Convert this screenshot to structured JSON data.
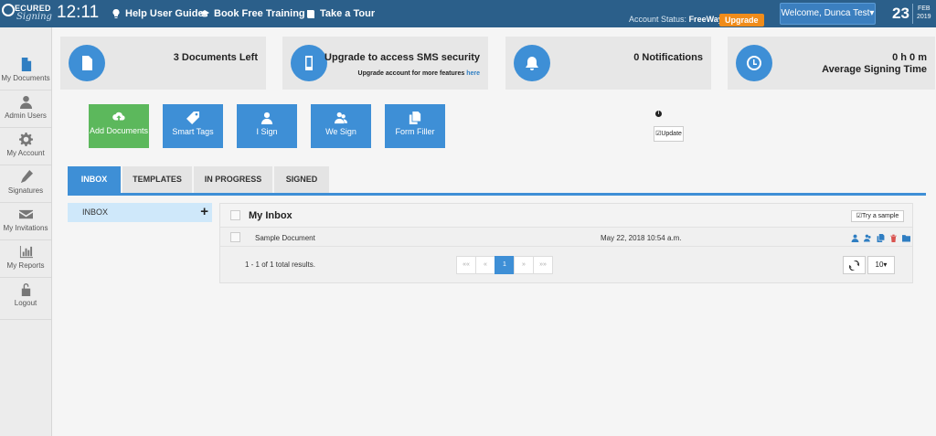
{
  "header": {
    "logo_top": "ECURED",
    "logo_script": "Signing",
    "time": "12:11",
    "nav": [
      "Help User Guide",
      "Book Free Training",
      "Take a Tour"
    ],
    "account_status_label": "Account Status:",
    "account_plan": "FreeWay",
    "upgrade_label": "Upgrade",
    "welcome": "Welcome, Dunca Test▾",
    "date_day": "23",
    "date_month": "FEB",
    "date_year": "2019"
  },
  "sidebar": {
    "items": [
      {
        "label": "My Documents",
        "icon": "document-icon"
      },
      {
        "label": "Admin Users",
        "icon": "user-icon"
      },
      {
        "label": "My Account",
        "icon": "gear-icon"
      },
      {
        "label": "Signatures",
        "icon": "pen-icon"
      },
      {
        "label": "My Invitations",
        "icon": "envelope-icon"
      },
      {
        "label": "My Reports",
        "icon": "bar-chart-icon"
      },
      {
        "label": "Logout",
        "icon": "lock-icon"
      }
    ]
  },
  "stats": {
    "documents_left": "3 Documents Left",
    "sms_title": "Upgrade to access SMS security",
    "sms_sub": "Upgrade account for more features",
    "sms_link": "here",
    "notifications": "0 Notifications",
    "signing_time_value": "0 h 0 m",
    "signing_time_label": "Average Signing Time"
  },
  "actions": {
    "add_documents": "Add Documents",
    "smart_tags": "Smart Tags",
    "i_sign": "I Sign",
    "we_sign": "We Sign",
    "form_filler": "Form Filler",
    "update": "Update"
  },
  "tabs": [
    "INBOX",
    "TEMPLATES",
    "IN PROGRESS",
    "SIGNED"
  ],
  "folders": {
    "inbox": "INBOX"
  },
  "inbox": {
    "title": "My Inbox",
    "try_sample": "Try a sample",
    "rows": [
      {
        "name": "Sample Document",
        "date": "May 22, 2018 10:54 a.m."
      }
    ],
    "results": "1 - 1 of 1 total results.",
    "pager": [
      "««",
      "«",
      "1",
      "»",
      "»»"
    ],
    "page_size": "10▾"
  },
  "colors": {
    "topbar": "#2b5f8a",
    "accent": "#3e8fd6",
    "green": "#5cb85c",
    "upgrade": "#f08c1a"
  }
}
